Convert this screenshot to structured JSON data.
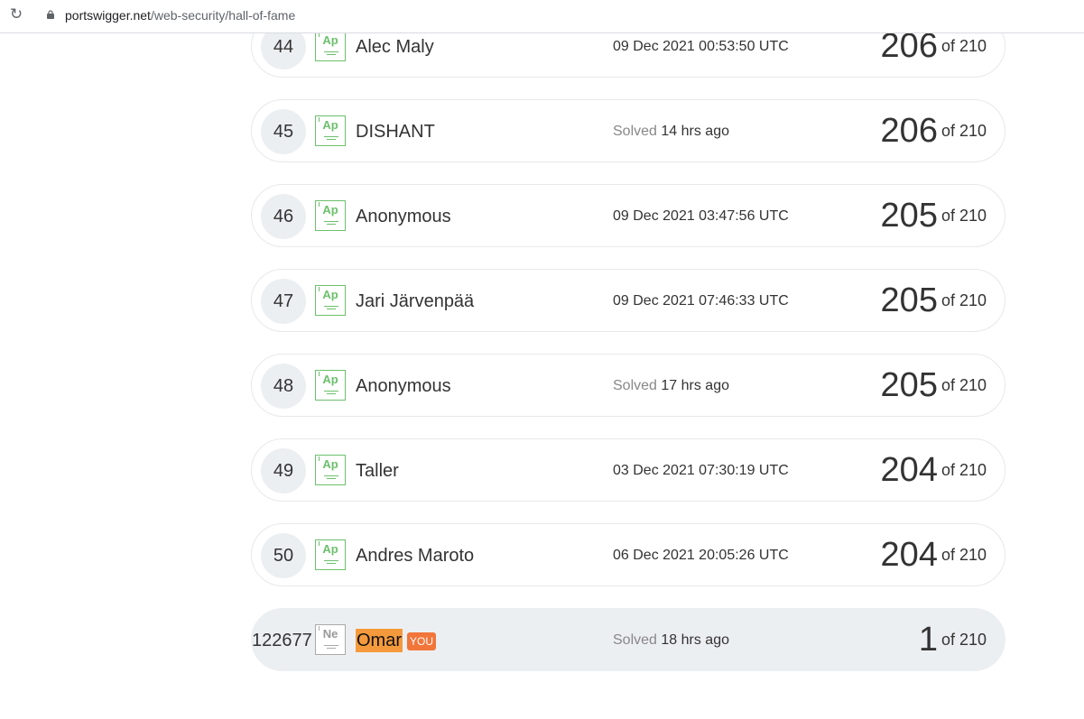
{
  "browser": {
    "url_host": "portswigger.net",
    "url_path": "/web-security/hall-of-fame"
  },
  "rows": [
    {
      "rank": "44",
      "badge": "Ap",
      "name": "Alec Maly",
      "when_prefix": "",
      "when": "09 Dec 2021 00:53:50 UTC",
      "score": "206",
      "total": "of 210"
    },
    {
      "rank": "45",
      "badge": "Ap",
      "name": "DISHANT",
      "when_prefix": "Solved",
      "when": "14 hrs ago",
      "score": "206",
      "total": "of 210"
    },
    {
      "rank": "46",
      "badge": "Ap",
      "name": "Anonymous",
      "when_prefix": "",
      "when": "09 Dec 2021 03:47:56 UTC",
      "score": "205",
      "total": "of 210"
    },
    {
      "rank": "47",
      "badge": "Ap",
      "name": "Jari Järvenpää",
      "when_prefix": "",
      "when": "09 Dec 2021 07:46:33 UTC",
      "score": "205",
      "total": "of 210"
    },
    {
      "rank": "48",
      "badge": "Ap",
      "name": "Anonymous",
      "when_prefix": "Solved",
      "when": "17 hrs ago",
      "score": "205",
      "total": "of 210"
    },
    {
      "rank": "49",
      "badge": "Ap",
      "name": "Taller",
      "when_prefix": "",
      "when": "03 Dec 2021 07:30:19 UTC",
      "score": "204",
      "total": "of 210"
    },
    {
      "rank": "50",
      "badge": "Ap",
      "name": "Andres Maroto",
      "when_prefix": "",
      "when": "06 Dec 2021 20:05:26 UTC",
      "score": "204",
      "total": "of 210"
    }
  ],
  "current_user": {
    "rank": "122677",
    "badge": "Ne",
    "name": "Omar",
    "you_label": "YOU",
    "when_prefix": "Solved",
    "when": "18 hrs ago",
    "score": "1",
    "total": "of 210"
  },
  "colors": {
    "apprentice_badge": "#6cc06c",
    "newcomer_badge": "#aaaaaa",
    "highlight": "#f59a3c",
    "you_badge": "#f2753a",
    "current_row_bg": "#eceff1"
  }
}
